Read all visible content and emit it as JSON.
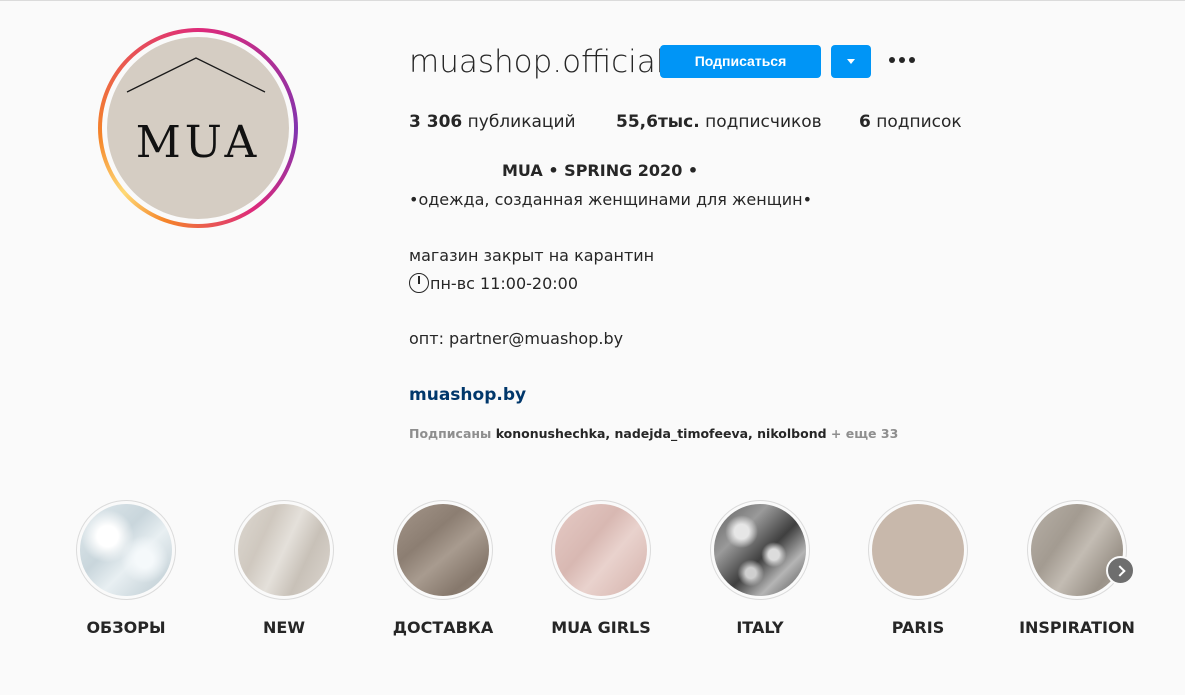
{
  "profile": {
    "username": "muashop.official",
    "avatar_text": "MUA",
    "follow_label": "Подписаться",
    "stats": {
      "posts_count": "3 306",
      "posts_label": "публикаций",
      "followers_count": "55,6тыс.",
      "followers_label": "подписчиков",
      "following_count": "6",
      "following_label": "подписок"
    },
    "bio": {
      "title": "MUA • SPRING 2020 •",
      "line1": "•одежда, созданная женщинами для женщин•",
      "line2": "магазин закрыт на карантин",
      "line3": "пн-вс 11:00-20:00",
      "line4": "опт: partner@muashop.by",
      "website": "muashop.by"
    },
    "followed_by": {
      "prefix": "Подписаны",
      "names": "kononushechka, nadejda_timofeeva, nikolbond",
      "more": "+ еще 33"
    }
  },
  "highlights": [
    {
      "label": "ОБЗОРЫ"
    },
    {
      "label": "NEW"
    },
    {
      "label": "ДОСТАВКА"
    },
    {
      "label": "MUA GIRLS"
    },
    {
      "label": "ITALY"
    },
    {
      "label": "PARIS"
    },
    {
      "label": "INSPIRATION"
    }
  ],
  "colors": {
    "accent": "#0095f6",
    "link": "#00376b",
    "text": "#262626",
    "muted": "#8e8e8e",
    "background": "#fafafa"
  },
  "icons": {
    "dropdown": "chevron-down-icon",
    "more": "more-dots-icon",
    "clock": "clock-icon",
    "next": "chevron-right-icon"
  }
}
